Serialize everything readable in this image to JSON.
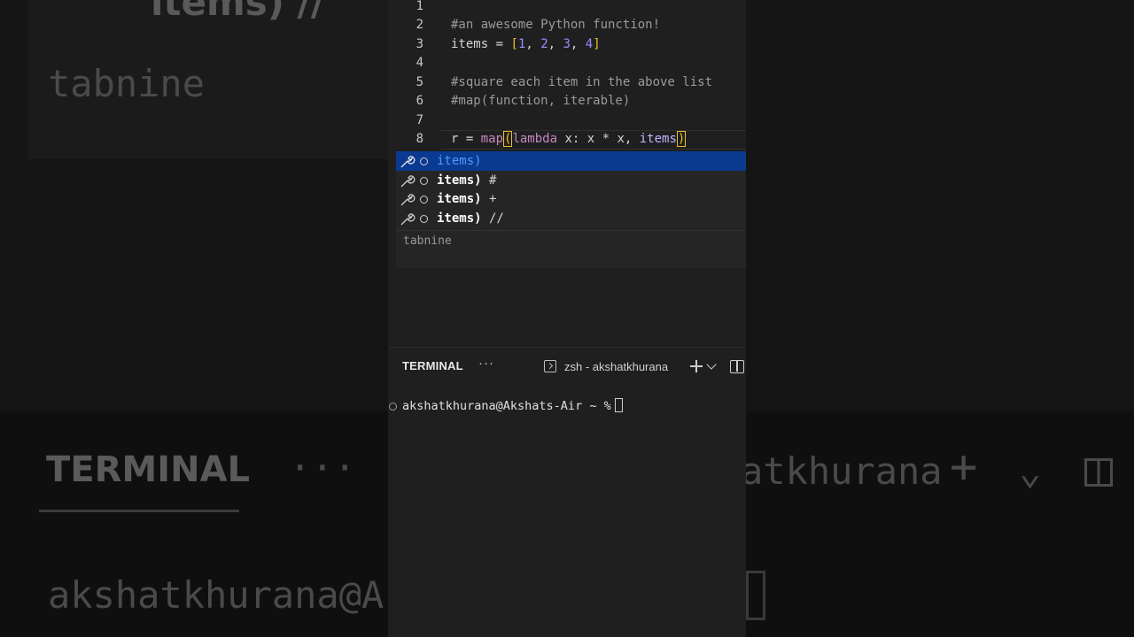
{
  "editor": {
    "lines": [
      {
        "n": "1",
        "text": ""
      },
      {
        "n": "2",
        "text": "#an awesome Python function!"
      },
      {
        "n": "3",
        "text": "items = [1, 2, 3, 4]"
      },
      {
        "n": "4",
        "text": ""
      },
      {
        "n": "5",
        "text": "#square each item in the above list"
      },
      {
        "n": "6",
        "text": "#map(function, iterable)"
      },
      {
        "n": "7",
        "text": ""
      },
      {
        "n": "8",
        "text": "r = map(lambda x: x * x, items)"
      }
    ],
    "line3": {
      "name": "items",
      "eq": " = ",
      "open": "[",
      "v1": "1",
      "v2": "2",
      "v3": "3",
      "v4": "4",
      "close": "]",
      "sep": ", "
    },
    "line8": {
      "pre": "r = ",
      "fn": "map",
      "open": "(",
      "kw": "lambda",
      "body": " x: x * x, ",
      "arg": "items",
      "close": ")"
    }
  },
  "suggestions": {
    "items": [
      {
        "match": "items)",
        "rest": ""
      },
      {
        "match": "items)",
        "rest": " #"
      },
      {
        "match": "items)",
        "rest": " +"
      },
      {
        "match": "items)",
        "rest": " //"
      }
    ],
    "detail": "tabnine",
    "icon": "wrench-icon"
  },
  "terminal": {
    "tab_label": "TERMINAL",
    "more_label": "···",
    "shell_name": "zsh - akshatkhurana",
    "prompt": "akshatkhurana@Akshats-Air ~ %"
  },
  "background": {
    "left_top_text": "items) //",
    "left_detail": "tabnine",
    "left_tab": "TERMINAL",
    "left_more": "···",
    "left_prompt": "akshatkhurana@A",
    "right_shell": "atkhurana"
  },
  "colors": {
    "editor_bg": "#1f1f1f",
    "selection_bg": "#0b3a91",
    "number": "#9b8cff",
    "bracket": "#e8c22a",
    "keyword": "#c586c0"
  }
}
